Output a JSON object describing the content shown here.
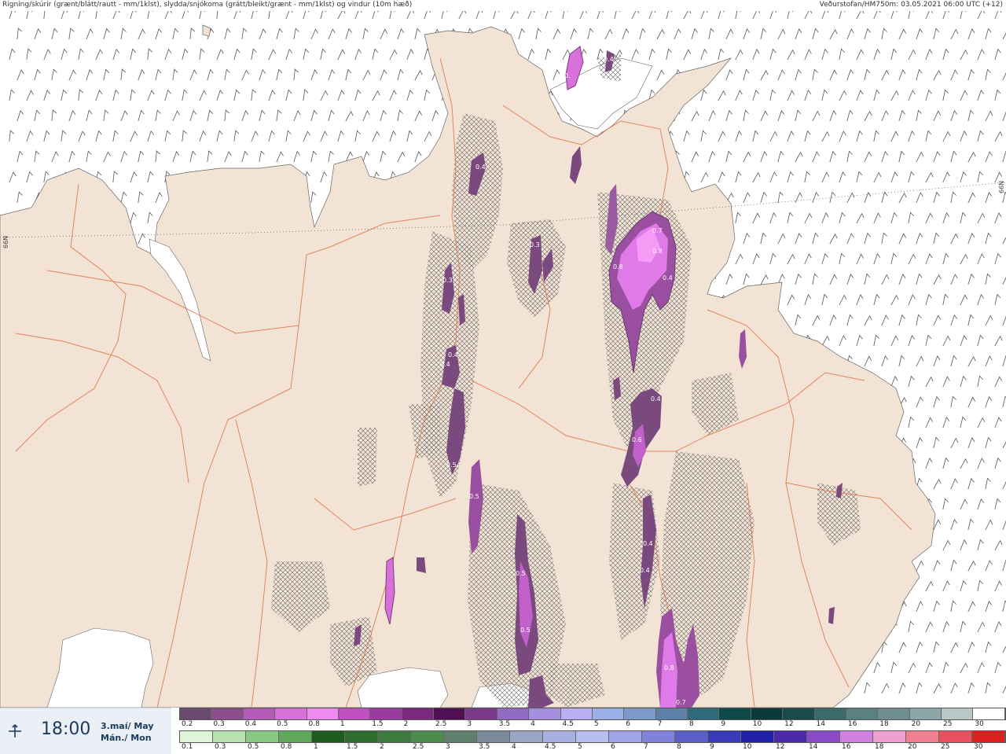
{
  "header": {
    "left": "Rigning/skúrir (grænt/blátt/rautt - mm/1klst), slydda/snjókoma (grátt/bleikt/grænt - mm/1klst) og vindur (10m hæð)",
    "right": "Veðurstofan/HM750m: 03.05.2021 06:00 UTC (+12)"
  },
  "grid_labels": {
    "left": "66N",
    "right": "66N"
  },
  "time_panel": {
    "icon": "wind-icon",
    "time": "18:00",
    "date_line1": "3.maí/ May",
    "date_line2": "Mán./ Mon"
  },
  "scale_top": {
    "labels": [
      "0.2",
      "0.3",
      "0.4",
      "0.5",
      "0.8",
      "1",
      "1.5",
      "2",
      "2.5",
      "3",
      "3.5",
      "4",
      "4.5",
      "5",
      "6",
      "7",
      "8",
      "9",
      "10",
      "12",
      "14",
      "16",
      "18",
      "20",
      "25",
      "30"
    ],
    "colors": [
      "#6a4a6e",
      "#8b4f8f",
      "#b45bb8",
      "#d770d9",
      "#f08af0",
      "#c04fc2",
      "#9a3a9e",
      "#7a2a7e",
      "#4f0f52",
      "#7a3a8a",
      "#8f6bc4",
      "#a58fe0",
      "#b8b0f2",
      "#9ab0e6",
      "#7d99c7",
      "#5e7fa8",
      "#2f6a7a",
      "#0f4a4a",
      "#0a3a3a",
      "#1a4a4a",
      "#3a6a6a",
      "#5a8080",
      "#6f8f8f",
      "#8fa6a6",
      "#b8c8c8",
      "#ffffff"
    ]
  },
  "scale_bottom": {
    "labels": [
      "0.1",
      "0.3",
      "0.5",
      "0.8",
      "1",
      "1.5",
      "2",
      "2.5",
      "3",
      "3.5",
      "4",
      "4.5",
      "5",
      "6",
      "7",
      "8",
      "9",
      "10",
      "12",
      "14",
      "16",
      "18",
      "20",
      "25",
      "30"
    ],
    "colors": [
      "#dff5d8",
      "#b8e2ae",
      "#8cc885",
      "#5fa85c",
      "#1f5a1f",
      "#2e6d2e",
      "#3f7a3f",
      "#4f8a4f",
      "#5f7f6f",
      "#7a8a9a",
      "#9aa4c4",
      "#a8b0e0",
      "#b8bff0",
      "#9fa4e8",
      "#7f82d8",
      "#5a5fc8",
      "#3a3ab8",
      "#2020a8",
      "#4a2aa8",
      "#8a4ac8",
      "#d080e0",
      "#f0a0d0",
      "#f08090",
      "#e85060",
      "#e02020"
    ]
  }
}
